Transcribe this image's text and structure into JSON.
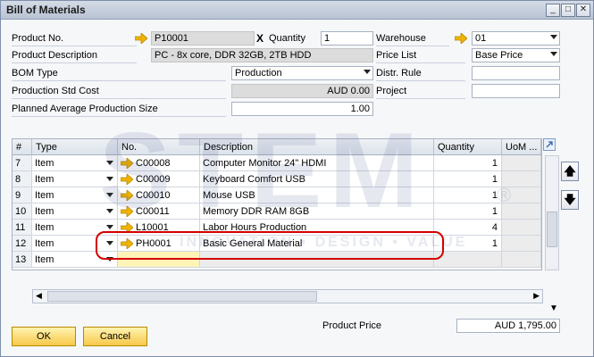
{
  "window": {
    "title": "Bill of Materials",
    "min_icon": "minimize-icon",
    "max_icon": "maximize-icon",
    "close_icon": "close-icon"
  },
  "header": {
    "product_no_label": "Product No.",
    "product_no": "P10001",
    "x_label": "X",
    "quantity_label": "Quantity",
    "quantity": "1",
    "warehouse_label": "Warehouse",
    "warehouse": "01",
    "product_description_label": "Product Description",
    "product_description": "PC - 8x core, DDR 32GB, 2TB HDD",
    "price_list_label": "Price List",
    "price_list": "Base Price",
    "bom_type_label": "BOM Type",
    "bom_type": "Production",
    "distr_rule_label": "Distr. Rule",
    "distr_rule": "",
    "std_cost_label": "Production Std Cost",
    "std_cost": "AUD 0.00",
    "project_label": "Project",
    "project": "",
    "planned_avg_label": "Planned Average Production Size",
    "planned_avg": "1.00"
  },
  "table": {
    "columns": [
      "#",
      "Type",
      "No.",
      "Description",
      "Quantity",
      "UoM ..."
    ],
    "rows": [
      {
        "num": "7",
        "type": "Item",
        "no": "C00008",
        "desc": "Computer Monitor 24\" HDMI",
        "qty": "1"
      },
      {
        "num": "8",
        "type": "Item",
        "no": "C00009",
        "desc": "Keyboard Comfort USB",
        "qty": "1"
      },
      {
        "num": "9",
        "type": "Item",
        "no": "C00010",
        "desc": "Mouse USB",
        "qty": "1"
      },
      {
        "num": "10",
        "type": "Item",
        "no": "C00011",
        "desc": "Memory DDR RAM 8GB",
        "qty": "1"
      },
      {
        "num": "11",
        "type": "Item",
        "no": "L10001",
        "desc": "Labor Hours Production",
        "qty": "4"
      },
      {
        "num": "12",
        "type": "Item",
        "no": "PH0001",
        "desc": "Basic General Material",
        "qty": "1"
      },
      {
        "num": "13",
        "type": "Item",
        "no": "",
        "desc": "",
        "qty": ""
      }
    ]
  },
  "footer": {
    "product_price_label": "Product Price",
    "product_price": "AUD 1,795.00",
    "ok_label": "OK",
    "cancel_label": "Cancel"
  },
  "watermark": {
    "big": "STEM",
    "tagline": "INNOVATION • DESIGN • VALUE",
    "reg": "®"
  },
  "colors": {
    "link_arrow": "#f0b400",
    "highlight": "#d40000",
    "button": "#f7c84a"
  }
}
